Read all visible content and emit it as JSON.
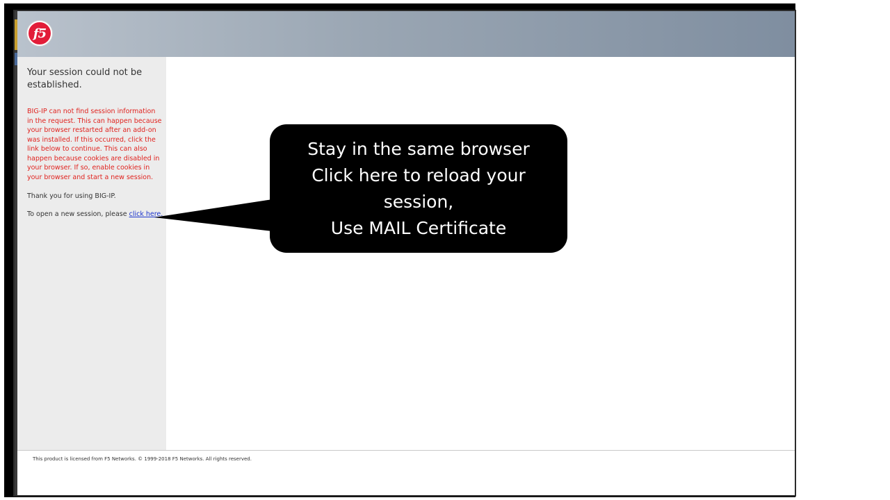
{
  "header": {
    "logo_text": "f5",
    "brand_color": "#e21d38"
  },
  "sidebar": {
    "title": "Your session could not be established.",
    "error_message": "BIG-IP can not find session information in the request. This can happen because your browser restarted after an add-on was installed. If this occurred, click the link below to continue. This can also happen because cookies are disabled in your browser. If so, enable cookies in your browser and start a new session.",
    "error_color": "#e0231f",
    "thanks": "Thank you for using BIG-IP.",
    "new_session_prefix": "To open a new session, please ",
    "new_session_link": "click here."
  },
  "footer": {
    "license": "This product is licensed from F5 Networks. © 1999-2018 F5 Networks. All rights reserved."
  },
  "callout": {
    "lines": [
      "Stay in the same browser",
      "Click here to reload your",
      "session,",
      "Use MAIL Certificate"
    ]
  }
}
